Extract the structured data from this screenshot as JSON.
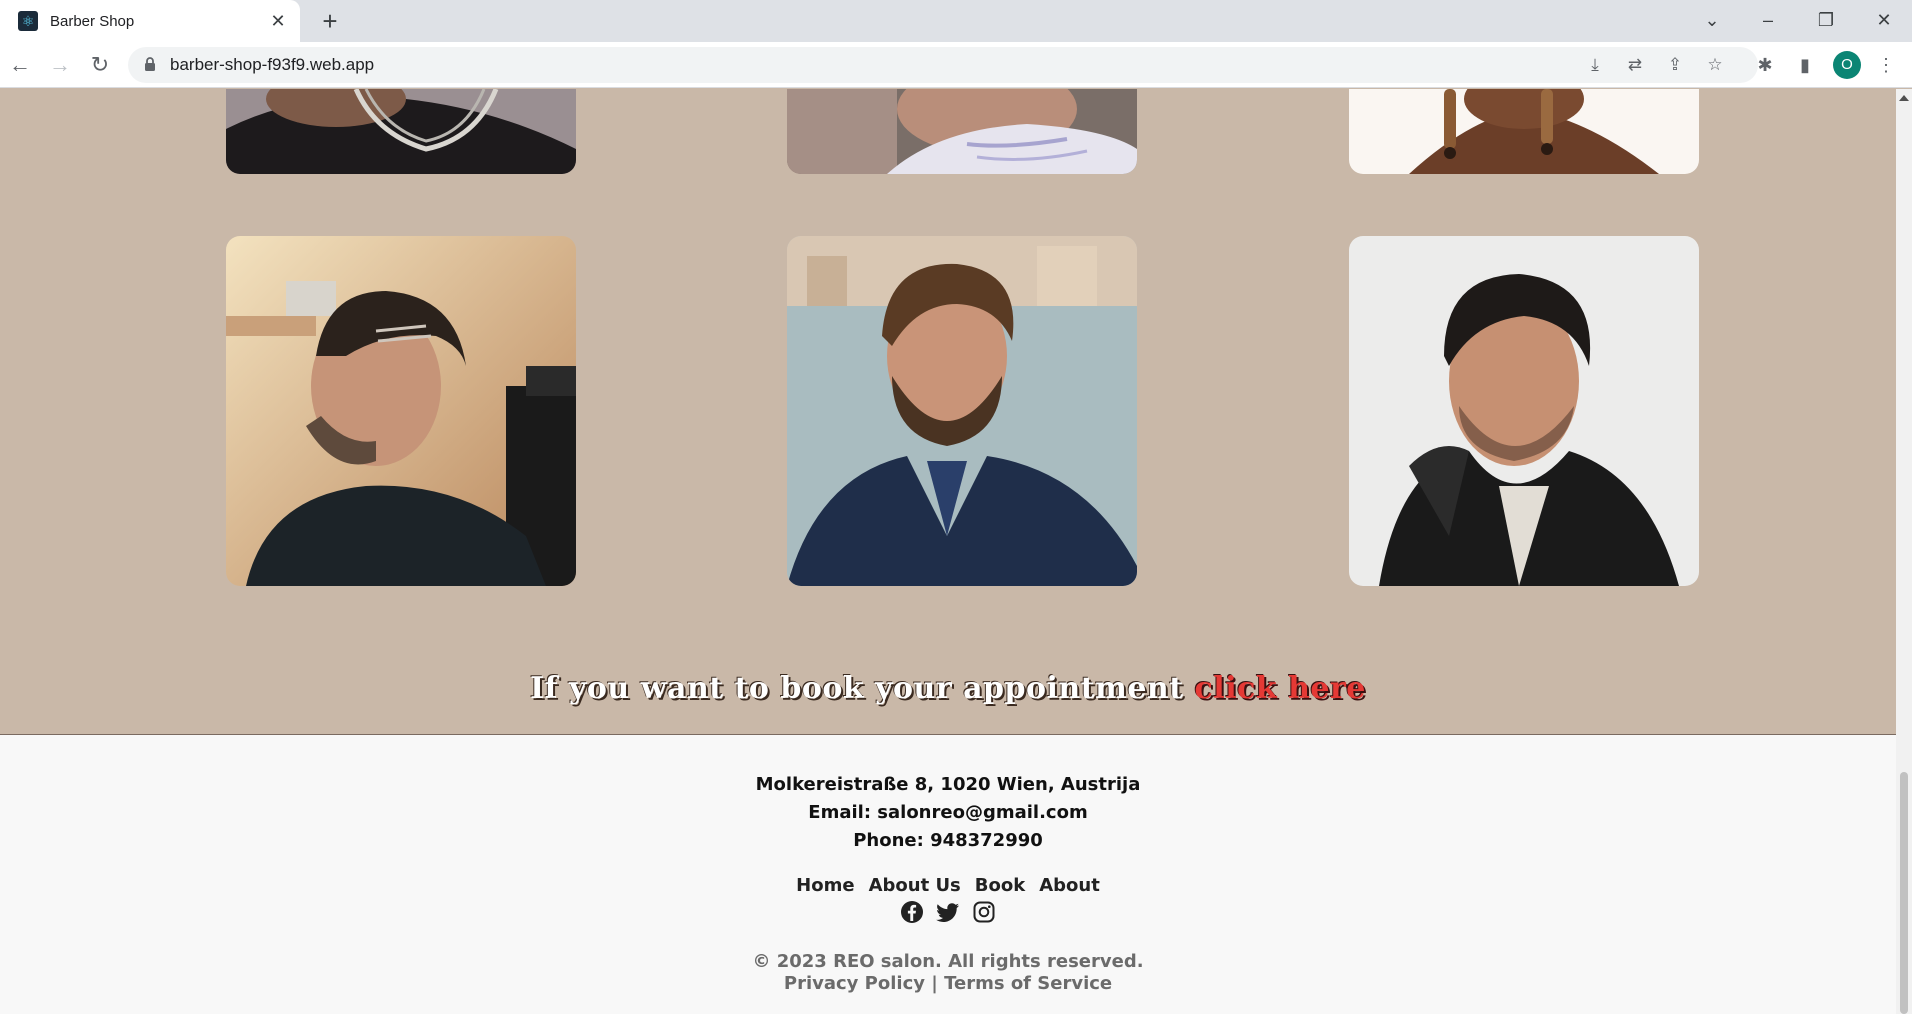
{
  "browser": {
    "tab_title": "Barber Shop",
    "url": "barber-shop-f93f9.web.app",
    "profile_initial": "O"
  },
  "gallery": {
    "top_row": [
      "photo-man-chain",
      "photo-man-shirt",
      "photo-woman-earrings"
    ],
    "bottom_row": [
      "photo-fade-haircut",
      "photo-bearded-man",
      "photo-short-crop"
    ]
  },
  "cta": {
    "text": "If you want to book your appointment",
    "link": "click here"
  },
  "footer": {
    "address": "Molkereistraße 8, 1020 Wien, Austrija",
    "email": "Email: salonreo@gmail.com",
    "phone": "Phone: 948372990",
    "nav": [
      "Home",
      "About Us",
      "Book",
      "About"
    ],
    "socials": [
      "facebook-icon",
      "twitter-icon",
      "instagram-icon"
    ],
    "copyright": "© 2023 REO salon. All rights reserved.",
    "privacy": "Privacy Policy",
    "separator": "|",
    "terms": "Terms of Service"
  },
  "colors": {
    "page_bg": "#c9b8a8",
    "footer_bg": "#f8f8f8",
    "cta_link": "#e53935"
  }
}
